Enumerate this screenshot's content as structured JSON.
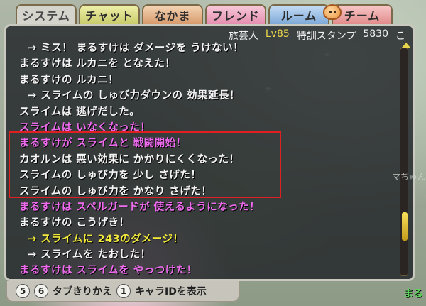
{
  "tabs": [
    {
      "label": "システム"
    },
    {
      "label": "チャット"
    },
    {
      "label": "なかま"
    },
    {
      "label": "フレンド"
    },
    {
      "label": "ルーム"
    },
    {
      "label": "チーム"
    }
  ],
  "status": {
    "job": "旅芸人",
    "level": "Lv85",
    "stamp": "特訓スタンプ",
    "points": "5830",
    "tail": "こ"
  },
  "log": [
    {
      "text": "→ ミス！ まるすけは ダメージを うけない！",
      "color": "white",
      "indent": true
    },
    {
      "text": "まるすけは ルカニを となえた！",
      "color": "white",
      "indent": false
    },
    {
      "text": "まるすけの ルカニ！",
      "color": "white",
      "indent": false
    },
    {
      "text": "→ スライムの しゅび力ダウンの 効果延長！",
      "color": "white",
      "indent": true
    },
    {
      "text": "スライムは 逃げだした。",
      "color": "white",
      "indent": false
    },
    {
      "text": "スライムは いなくなった！",
      "color": "pink",
      "indent": false
    },
    {
      "text": "まるすけが スライムと 戦闘開始！",
      "color": "pink",
      "indent": false
    },
    {
      "text": "カオルンは 悪い効果に かかりにくくなった！",
      "color": "white",
      "indent": false
    },
    {
      "text": "スライムの しゅび力を 少し さげた！",
      "color": "white",
      "indent": false
    },
    {
      "text": "スライムの しゅび力を かなり さげた！",
      "color": "white",
      "indent": false
    },
    {
      "text": "まるすけは スペルガードが 使えるようになった！",
      "color": "pink",
      "indent": false
    },
    {
      "text": "まるすけの こうげき！",
      "color": "white",
      "indent": false
    },
    {
      "text": "→ スライムに 243のダメージ！",
      "color": "yellow",
      "indent": true
    },
    {
      "text": "→ スライムを たおした！",
      "color": "white",
      "indent": true
    },
    {
      "text": "まるすけは スライムを やっつけた！",
      "color": "pink",
      "indent": false
    }
  ],
  "bottom_bar": {
    "key1": "5",
    "key2": "6",
    "switch_label": "タブきりかえ",
    "key3": "1",
    "id_label": "キャラIDを表示"
  },
  "side_label": "マちゅん",
  "corner_label": "まる"
}
